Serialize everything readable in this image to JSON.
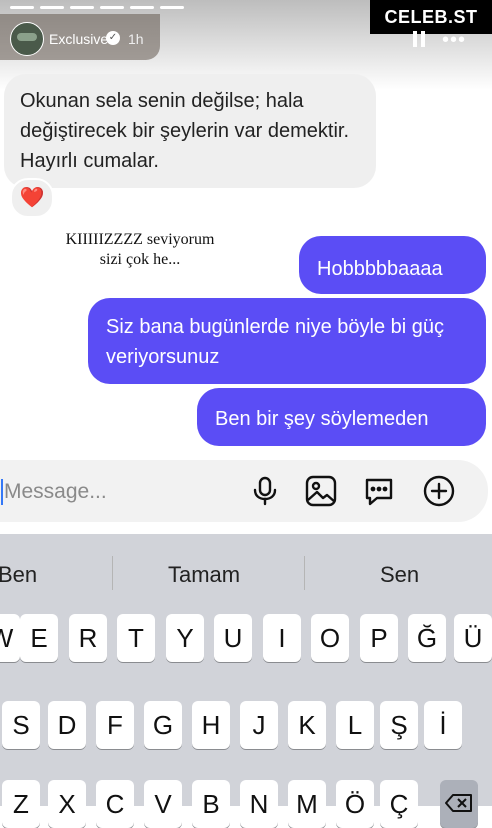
{
  "story": {
    "author": "Exclusive",
    "time": "1h",
    "brand": "CELEB.ST"
  },
  "chat": {
    "incoming_message": "Okunan sela senin değilse; hala değiştirecek bir şeylerin var demektir. Hayırlı cumalar.",
    "reaction": "❤️",
    "caption_line1": "KIIIIIZZZZ seviyorum",
    "caption_line2": "sizi çok he...",
    "outgoing": [
      "Hobbbbbaaaa",
      "Siz bana bugünlerde niye böyle bi güç veriyorsunuz",
      "Ben bir şey söylemeden"
    ]
  },
  "composer": {
    "placeholder": "Message..."
  },
  "keyboard": {
    "suggestions": [
      "Ben",
      "Tamam",
      "Sen"
    ],
    "row1": [
      "W",
      "E",
      "R",
      "T",
      "Y",
      "U",
      "I",
      "O",
      "P",
      "Ğ",
      "Ü"
    ],
    "row2": [
      "S",
      "D",
      "F",
      "G",
      "H",
      "J",
      "K",
      "L",
      "Ş",
      "İ"
    ],
    "row3": [
      "Z",
      "X",
      "C",
      "V",
      "B",
      "N",
      "M",
      "Ö",
      "Ç"
    ]
  }
}
